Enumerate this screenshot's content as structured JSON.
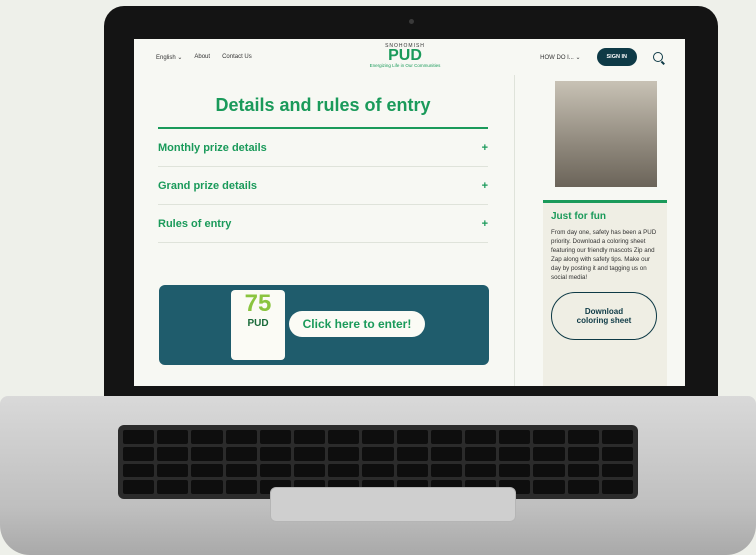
{
  "header": {
    "language": "English ⌄",
    "about": "About",
    "contact": "Contact Us",
    "logo_small": "SNOHOMISH",
    "logo_big": "PUD",
    "logo_tag": "Energizing Life in Our Communities",
    "how_do_i": "HOW DO I... ⌄",
    "sign_in": "SIGN IN"
  },
  "main": {
    "title": "Details and rules of entry",
    "accordions": [
      {
        "label": "Monthly prize details",
        "icon": "+"
      },
      {
        "label": "Grand prize details",
        "icon": "+"
      },
      {
        "label": "Rules of entry",
        "icon": "+"
      }
    ],
    "banner": {
      "number": "75",
      "pud": "PUD",
      "cta": "Click here to enter!"
    }
  },
  "sidebar": {
    "fun_title": "Just for fun",
    "fun_text": "From day one, safety has been a PUD priority. Download a coloring sheet featuring our friendly mascots Zip and Zap along with safety tips. Make our day by posting it and tagging us on social media!",
    "download_label": "Download coloring sheet"
  },
  "colors": {
    "accent": "#1a9a5a",
    "navy": "#0e3a46",
    "banner": "#1f5c6c"
  }
}
